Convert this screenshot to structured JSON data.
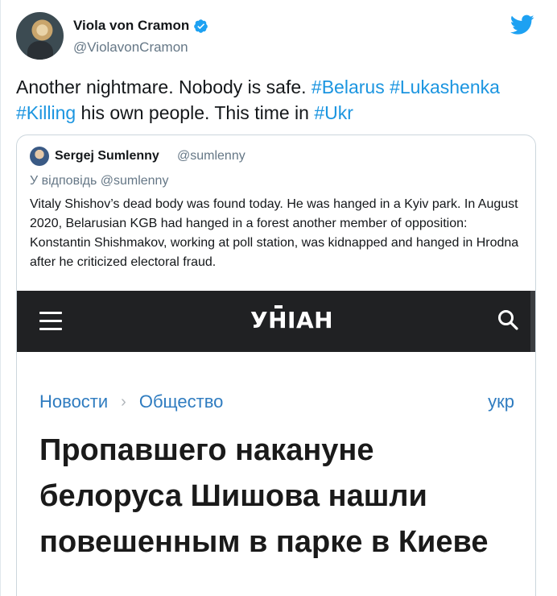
{
  "tweet": {
    "author_name": "Viola von Cramon",
    "author_handle": "@ViolavonCramon",
    "text_parts": [
      {
        "t": "Another nightmare. Nobody is safe. ",
        "tag": false
      },
      {
        "t": "#Belarus",
        "tag": true
      },
      {
        "t": " ",
        "tag": false
      },
      {
        "t": "#Lukashenka",
        "tag": true
      },
      {
        "t": " ",
        "tag": false
      },
      {
        "t": "#Killing",
        "tag": true
      },
      {
        "t": " his own people. This time in ",
        "tag": false
      },
      {
        "t": "#Ukr",
        "tag": true
      }
    ]
  },
  "quote": {
    "author_name": "Sergej Sumlenny",
    "author_handle": "@sumlenny",
    "reply_to": "У відповідь @sumlenny",
    "body": "Vitaly Shishov’s dead body was found today. He was hanged in a Kyiv park. In August 2020, Belarusian KGB had hanged in a forest another member of opposition: Konstantin Shishmakov, working at poll station, was kidnapped and hanged in Hrodna after he criticized electoral fraud."
  },
  "site": {
    "logo": "УНІАН",
    "breadcrumb": [
      "Новости",
      "Общество"
    ],
    "breadcrumb_sep": "›",
    "lang": "укр",
    "headline": "Пропавшего накануне белоруса Шишова нашли повешенным в парке в Киеве"
  },
  "colors": {
    "hashtag": "#1b95e0",
    "twitter_blue": "#1da1f2",
    "site_bar": "#202123",
    "link": "#2f7cc0"
  },
  "icons": {
    "verified": "verified-badge-icon",
    "twitter": "twitter-bird-icon",
    "menu": "hamburger-icon",
    "search": "search-icon"
  }
}
